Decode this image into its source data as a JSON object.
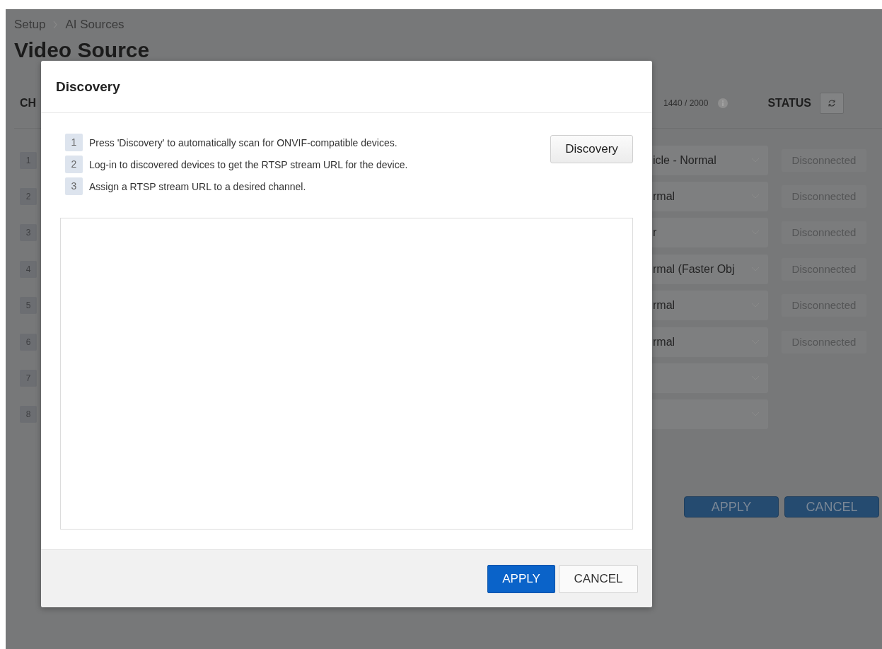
{
  "breadcrumb": [
    {
      "label": "Setup"
    },
    {
      "label": "AI Sources"
    }
  ],
  "page_title": "Video Source",
  "table": {
    "columns": {
      "channel": "CH",
      "usage": "1440 / 2000",
      "status": "STATUS"
    },
    "rows": [
      {
        "channel": "1",
        "model": "icle - Normal",
        "status": "Disconnected"
      },
      {
        "channel": "2",
        "model": "rmal",
        "status": "Disconnected"
      },
      {
        "channel": "3",
        "model": "r",
        "status": "Disconnected"
      },
      {
        "channel": "4",
        "model": "rmal (Faster Obj",
        "status": "Disconnected"
      },
      {
        "channel": "5",
        "model": "rmal",
        "status": "Disconnected"
      },
      {
        "channel": "6",
        "model": "rmal",
        "status": "Disconnected"
      },
      {
        "channel": "7"
      },
      {
        "channel": "8"
      }
    ]
  },
  "actions": [
    "APPLY",
    "CANCEL"
  ],
  "dialog": {
    "title": "Discovery",
    "steps": [
      {
        "number": "1",
        "text": "Press 'Discovery' to automatically scan for ONVIF-compatible devices."
      },
      {
        "number": "2",
        "text": "Log-in to discovered devices to get the RTSP stream URL for the device."
      },
      {
        "number": "3",
        "text": "Assign a RTSP stream URL to a desired channel."
      }
    ],
    "discovery_button": "Discovery",
    "buttons": [
      {
        "label": "APPLY",
        "kind": "primary"
      },
      {
        "label": "CANCEL",
        "kind": "secondary"
      }
    ]
  }
}
